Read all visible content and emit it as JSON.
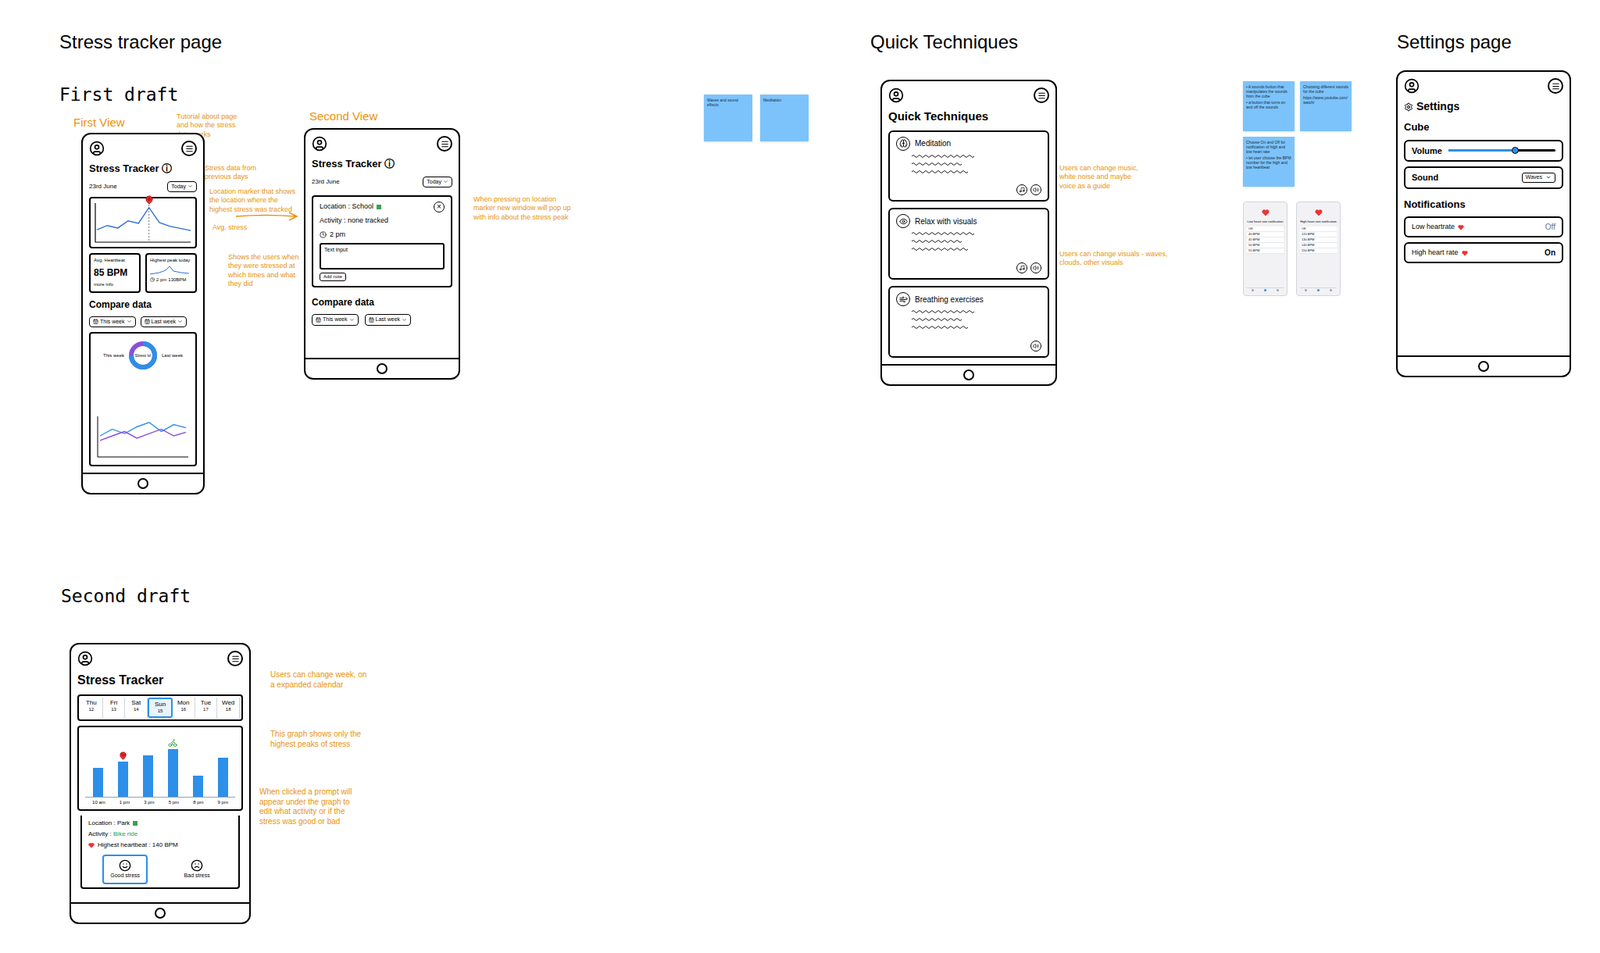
{
  "headings": {
    "stress_tracker": "Stress tracker page",
    "first_draft": "First draft",
    "second_draft": "Second draft",
    "quick_techniques": "Quick Techniques",
    "settings": "Settings page"
  },
  "notes": [
    "First View",
    "Tutorial about page and how the stress data works",
    "Stress data from previous days",
    "Location marker that shows the location where the highest stress was tracked",
    "Avg. stress",
    "Shows the users when they were stressed at which times and what they did",
    "Second View",
    "When pressing on location marker new window will pop up with info about the stress peak",
    "Users can change week, on a expanded calendar",
    "This graph shows only the highest peaks of stress",
    "When clicked a prompt will appear under the graph to edit what activity or if the stress was good or bad",
    "Users can change music, white noise and maybe voice as a guide",
    "Users can change visuals - waves, clouds, other visuals"
  ],
  "first_view": {
    "title": "Stress Tracker",
    "info": "ⓘ",
    "date": "23rd June",
    "range": "Today",
    "chart": [
      30,
      42,
      35,
      55,
      48,
      92,
      50,
      40,
      34,
      28
    ],
    "cards": [
      {
        "title": "Avg. Heartbeat",
        "value": "85 BPM",
        "note": "more info"
      },
      {
        "title": "Highest peak today",
        "value": "2 pm",
        "note": "130BPM"
      }
    ],
    "compare_title": "Compare data",
    "filters": [
      "This week",
      "Last week"
    ],
    "donut": {
      "label": "Stress lvl",
      "level": 0.75,
      "this_week": "This week",
      "last_week": "Last week"
    },
    "series": [
      [
        40,
        55,
        45,
        60,
        70,
        50,
        65,
        58
      ],
      [
        30,
        40,
        50,
        35,
        45,
        55,
        40,
        48
      ]
    ]
  },
  "second_view": {
    "title": "Stress Tracker",
    "info": "ⓘ",
    "date": "23rd June",
    "range": "Today",
    "close": "×",
    "location": "Location : School",
    "activity": "Activity : none tracked",
    "time": "2 pm",
    "input": "Text input",
    "add_note": "Add note",
    "compare_title": "Compare data",
    "filters": [
      "This week",
      "Last week"
    ]
  },
  "second_draft": {
    "title": "Stress Tracker",
    "days": [
      {
        "day": "Thu",
        "date": "12",
        "selected": false
      },
      {
        "day": "Fri",
        "date": "13",
        "selected": false
      },
      {
        "day": "Sat",
        "date": "14",
        "selected": false
      },
      {
        "day": "Sun",
        "date": "15",
        "selected": true
      },
      {
        "day": "Mon",
        "date": "16",
        "selected": false
      },
      {
        "day": "Tue",
        "date": "17",
        "selected": false
      },
      {
        "day": "Wed",
        "date": "18",
        "selected": false
      }
    ],
    "bars": [
      {
        "label": "10 am",
        "value": 55,
        "kind": "none"
      },
      {
        "label": "1 pm",
        "value": 68,
        "kind": "location"
      },
      {
        "label": "3 pm",
        "value": 80,
        "kind": "none"
      },
      {
        "label": "5 pm",
        "value": 92,
        "kind": "activity"
      },
      {
        "label": "8 pm",
        "value": 40,
        "kind": "none"
      },
      {
        "label": "9 pm",
        "value": 75,
        "kind": "none"
      }
    ],
    "location": "Location : Park",
    "activity_label": "Activity :",
    "activity": "Bike ride",
    "heartbeat": "Highest heartbeat : 140 BPM",
    "moods": [
      {
        "label": "Good stress",
        "kind": "good",
        "selected": true
      },
      {
        "label": "Bad stress",
        "kind": "bad",
        "selected": false
      }
    ]
  },
  "quick_techniques": {
    "title": "Quick Techniques",
    "cards": [
      {
        "title": "Meditation",
        "kind": "meditation",
        "music": true
      },
      {
        "title": "Relax with visuals",
        "kind": "visuals",
        "music": true
      },
      {
        "title": "Breathing exercises",
        "kind": "breathing",
        "music": false
      }
    ]
  },
  "settings": {
    "title": "Settings",
    "section": "Cube",
    "volume": {
      "label": "Volume",
      "level": 0.62
    },
    "sound": {
      "label": "Sound",
      "value": "Waves"
    },
    "notifications": "Notifications",
    "toggles": [
      {
        "label": "Low heartrate",
        "value": "Off",
        "on": false
      },
      {
        "label": "High heart rate",
        "value": "On",
        "on": true
      }
    ]
  },
  "stickies_left": [
    "Waves and sound effects",
    "Meditation"
  ],
  "stickies_right": [
    [
      "• A sounds button that manipulates the sounds from the cube",
      "• a button that turns on and off the sounds"
    ],
    [
      "Choosing different sounds for the cube",
      "https://www.youtube.com/watch/"
    ],
    [
      "Choose On and Off for notification of high and low heart rate",
      "• let user choose the BPM number for the high and low heartbeat"
    ]
  ],
  "screenshots": [
    {
      "title": "Low heart rate notification",
      "rows": [
        "Off",
        "40 BPM",
        "45 BPM",
        "50 BPM",
        "55 BPM"
      ]
    },
    {
      "title": "High heart rate notification",
      "rows": [
        "Off",
        "120 BPM",
        "130 BPM",
        "140 BPM",
        "150 BPM"
      ]
    }
  ]
}
